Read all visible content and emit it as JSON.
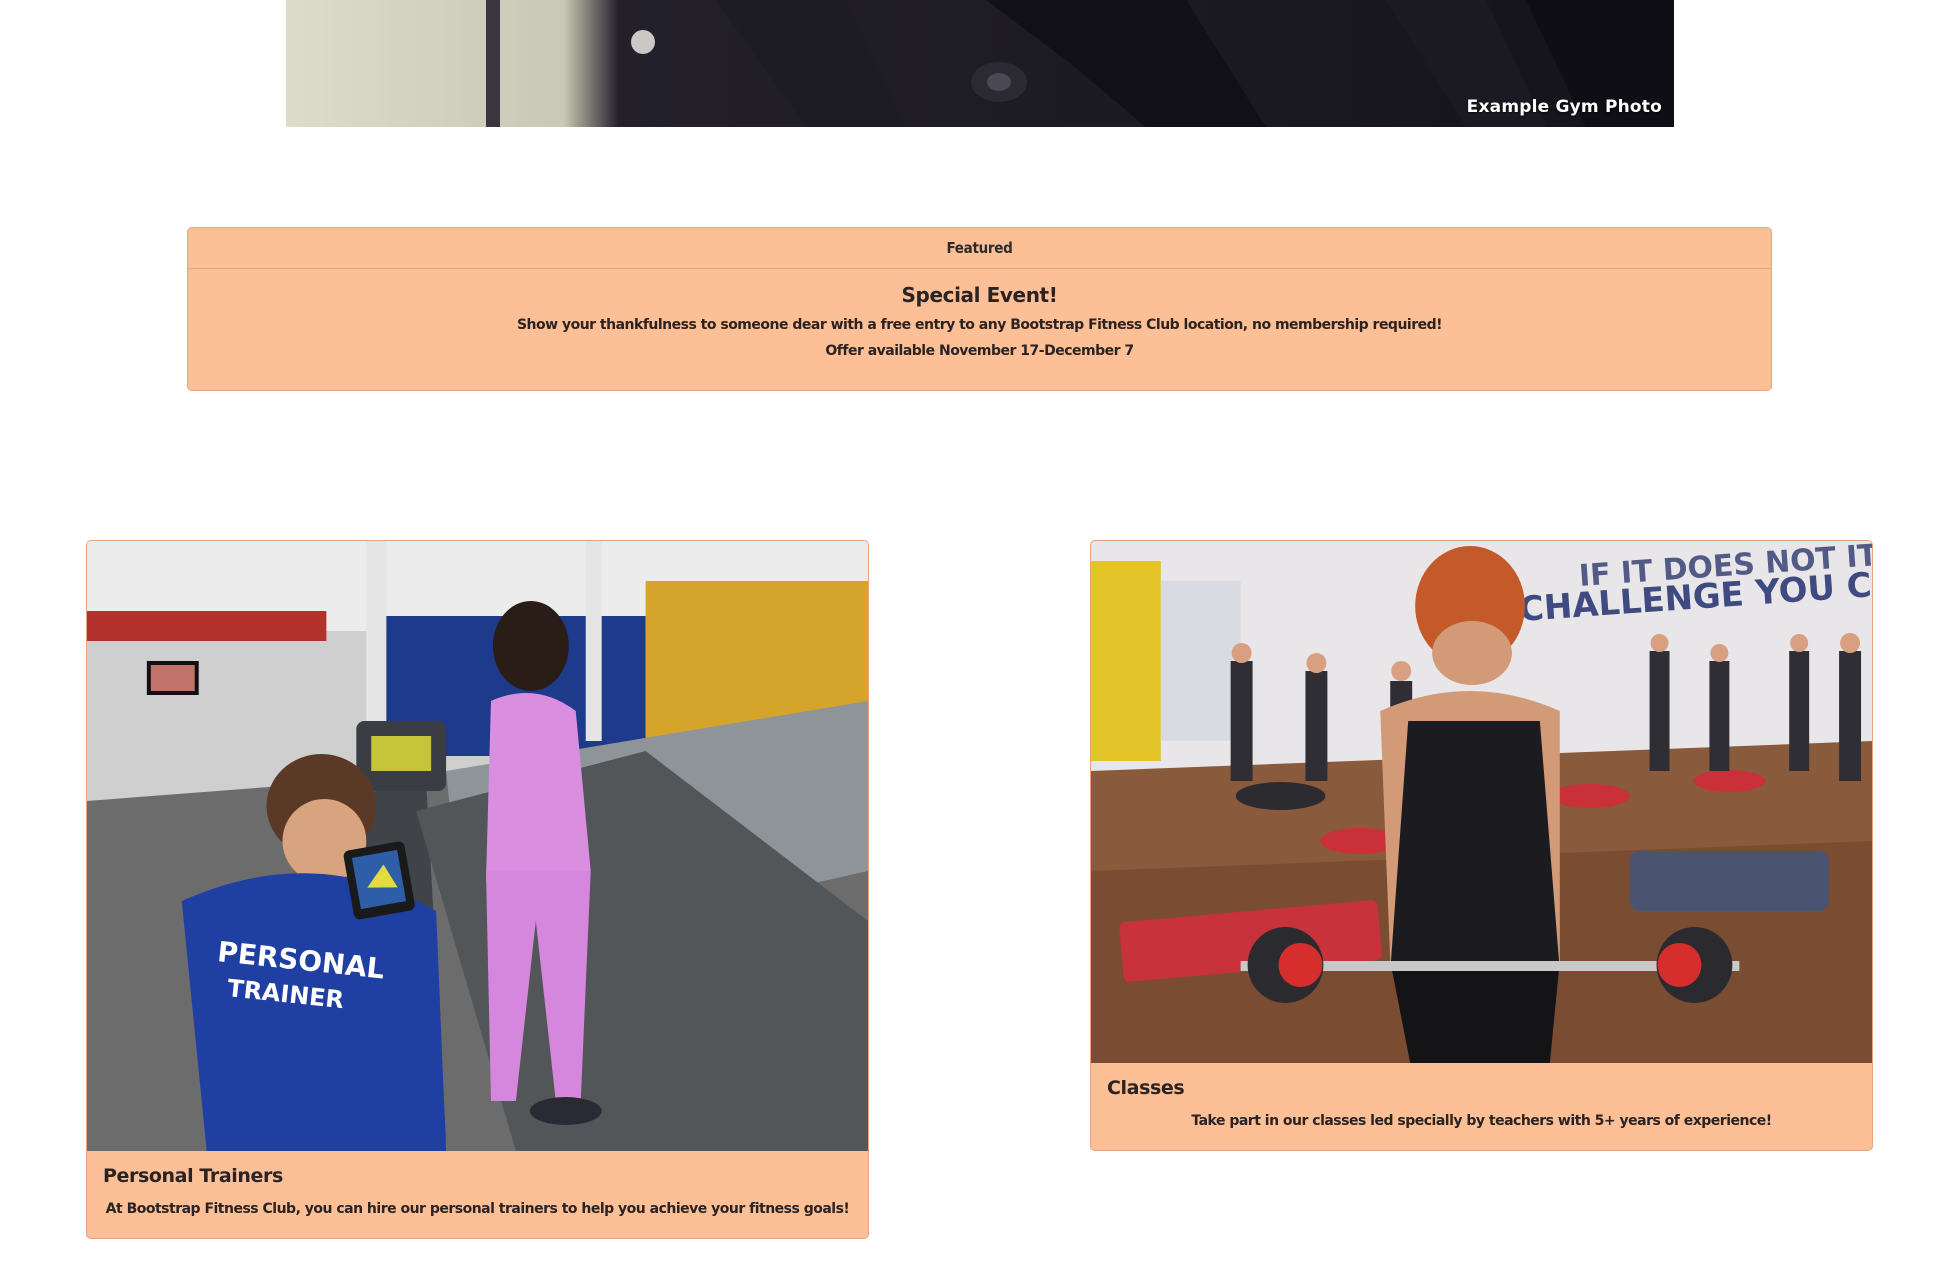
{
  "hero": {
    "caption": "Example Gym Photo"
  },
  "featured": {
    "header": "Featured",
    "title": "Special Event!",
    "text": "Show your thankfulness to someone dear with a free entry to any Bootstrap Fitness Club location, no membership required!",
    "offer": "Offer available November 17-December 7"
  },
  "cards": [
    {
      "title": "Personal Trainers",
      "text": "At Bootstrap Fitness Club, you can hire our personal trainers to help you achieve your fitness goals!",
      "image_icon": "photo-trainer-treadmill"
    },
    {
      "title": "Classes",
      "text": "Take part in our classes led specially by teachers with 5+ years of experience!",
      "image_icon": "photo-group-barbell-class"
    }
  ],
  "colors": {
    "card_background": "#fcbf96",
    "card_border": "#e6a57e",
    "text": "#2b2222",
    "page_background": "#ffffff"
  }
}
